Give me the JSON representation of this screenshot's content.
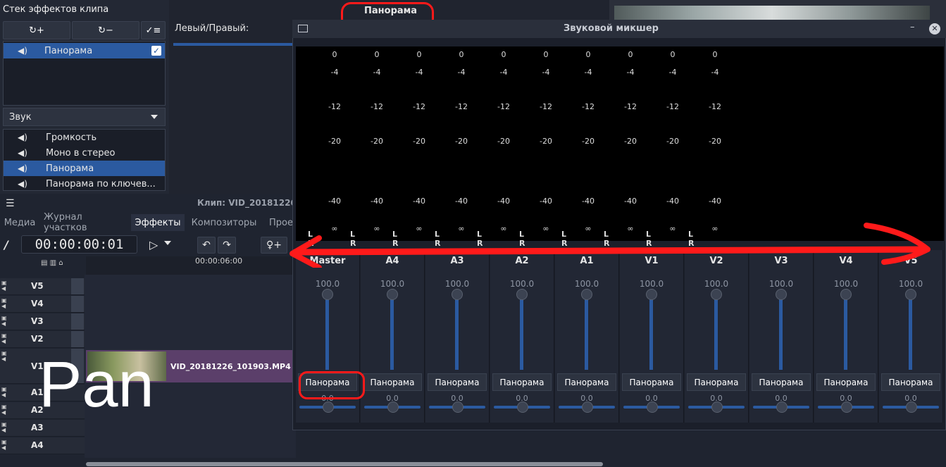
{
  "effects_panel": {
    "title": "Стек эффектов клипа",
    "add_button": "↻+",
    "remove_button": "↻−",
    "stack_items": [
      {
        "label": "Панорама",
        "checked": true
      }
    ],
    "category": "Звук",
    "effects": [
      "Громкость",
      "Моно в стерео",
      "Панорама",
      "Панорама по ключев..."
    ]
  },
  "param_panel": {
    "title": "Панорама",
    "param_label": "Левый/Правый:"
  },
  "clip_info": "Клип: VID_20181226",
  "tabs": [
    "Медиа",
    "Журнал участков",
    "Эффекты",
    "Композиторы",
    "Прое"
  ],
  "timeline": {
    "timecode": "00:00:00:01",
    "ruler_label": "00:00:06:00",
    "tracks": [
      "V5",
      "V4",
      "V3",
      "V2",
      "V1",
      "A1",
      "A2",
      "A3",
      "A4"
    ],
    "clip_name": "VID_20181226_101903.MP4"
  },
  "annotation": {
    "pan_text": "Pan"
  },
  "mixer": {
    "title": "Звуковой микшер",
    "scale": [
      "0",
      "-4",
      "-12",
      "-20",
      "-40",
      "∞"
    ],
    "channels": [
      {
        "name": "Master",
        "volume": "100.0",
        "pan_label": "Панорама",
        "pan_value": "0.0"
      },
      {
        "name": "A4",
        "volume": "100.0",
        "pan_label": "Панорама",
        "pan_value": "0.0"
      },
      {
        "name": "A3",
        "volume": "100.0",
        "pan_label": "Панорама",
        "pan_value": "0.0"
      },
      {
        "name": "A2",
        "volume": "100.0",
        "pan_label": "Панорама",
        "pan_value": "0.0"
      },
      {
        "name": "A1",
        "volume": "100.0",
        "pan_label": "Панорама",
        "pan_value": "0.0"
      },
      {
        "name": "V1",
        "volume": "100.0",
        "pan_label": "Панорама",
        "pan_value": "0.0"
      },
      {
        "name": "V2",
        "volume": "100.0",
        "pan_label": "Панорама",
        "pan_value": "0.0"
      },
      {
        "name": "V3",
        "volume": "100.0",
        "pan_label": "Панорама",
        "pan_value": "0.0"
      },
      {
        "name": "V4",
        "volume": "100.0",
        "pan_label": "Панорама",
        "pan_value": "0.0"
      },
      {
        "name": "V5",
        "volume": "100.0",
        "pan_label": "Панорама",
        "pan_value": "0.0"
      }
    ]
  },
  "colors": {
    "accent": "#2b5aa0",
    "annotation": "#ff1a1a"
  }
}
